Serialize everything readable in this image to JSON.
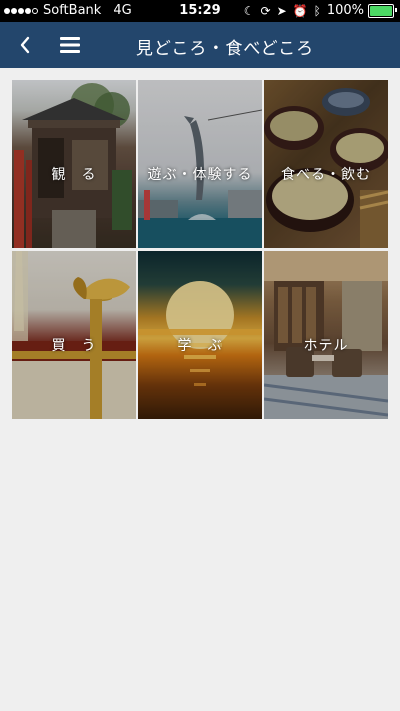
{
  "status_bar": {
    "carrier": "SoftBank",
    "network": "4G",
    "time": "15:29",
    "battery_percent": "100%",
    "battery_level": 1.0,
    "battery_color": "#4cd964"
  },
  "nav": {
    "title": "見どころ・食べどころ",
    "back_icon": "chevron-left-icon",
    "menu_icon": "hamburger-menu-icon",
    "background_color": "#23466c"
  },
  "categories": [
    {
      "label": "観　る"
    },
    {
      "label": "遊ぶ・体験する"
    },
    {
      "label": "食べる・飲む"
    },
    {
      "label": "買　う"
    },
    {
      "label": "学　ぶ"
    },
    {
      "label": "ホテル"
    }
  ]
}
